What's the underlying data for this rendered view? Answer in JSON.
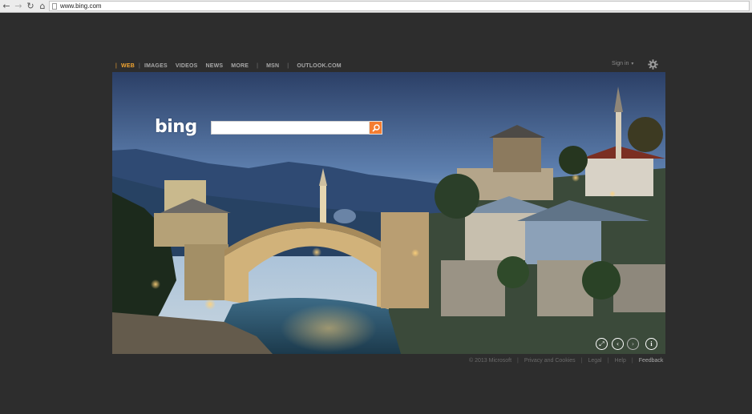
{
  "browser": {
    "url": "www.bing.com",
    "back_icon": "←",
    "forward_icon": "→",
    "reload_icon": "↻",
    "home_icon": "⌂"
  },
  "nav": {
    "items": [
      "WEB",
      "IMAGES",
      "VIDEOS",
      "NEWS",
      "MORE",
      "MSN",
      "OUTLOOK.COM"
    ],
    "separator": "|"
  },
  "header": {
    "signin_label": "Sign in",
    "signin_caret": "▾"
  },
  "search": {
    "logo_text": "bing",
    "value": ""
  },
  "hero_controls": {
    "expand_icon": "⤢",
    "prev_icon": "‹",
    "next_icon": "›",
    "info_icon": "i"
  },
  "footer": {
    "copyright": "© 2013 Microsoft",
    "links": [
      "Privacy and Cookies",
      "Legal",
      "Help"
    ],
    "feedback": "Feedback",
    "separator": "|"
  },
  "colors": {
    "page_bg": "#2d2d2d",
    "nav_active": "#f2a531",
    "search_button": "#f47d31"
  }
}
